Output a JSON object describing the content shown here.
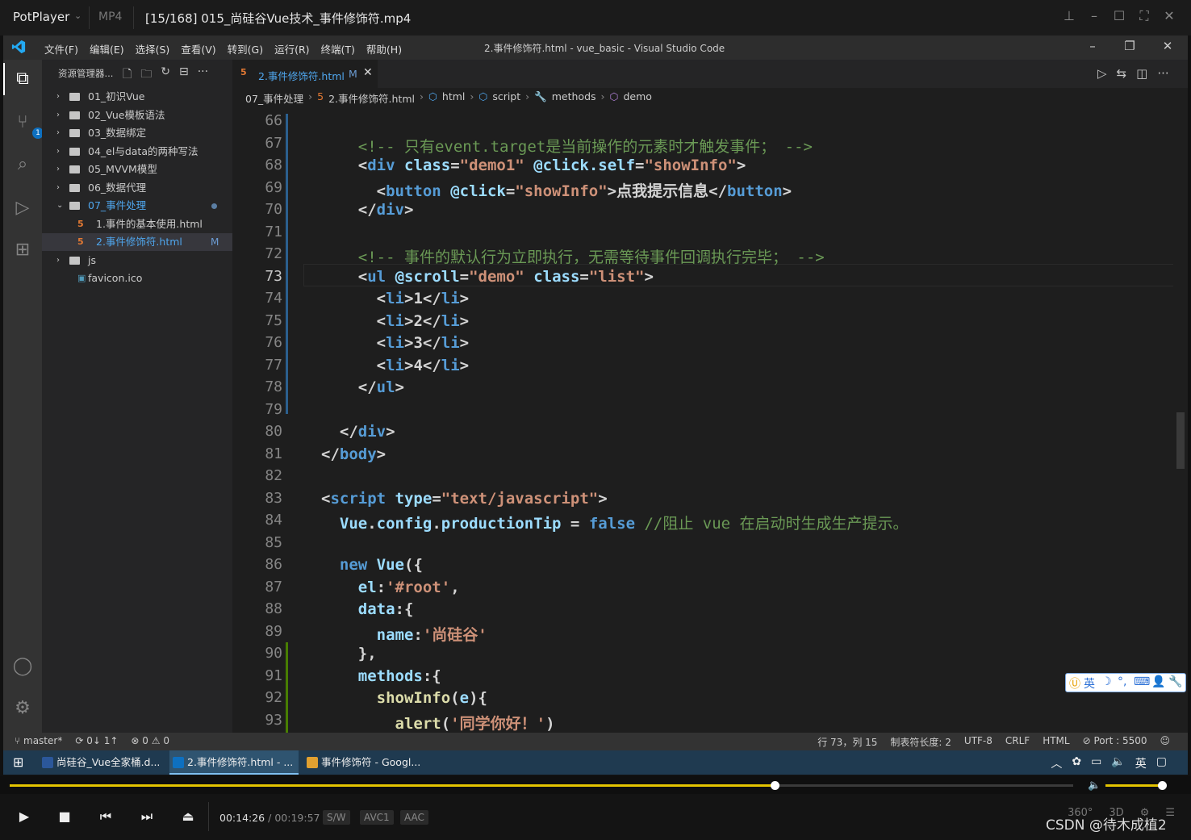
{
  "player": {
    "app_name": "PotPlayer",
    "format": "MP4",
    "file_title": "[15/168] 015_尚硅谷Vue技术_事件修饰符.mp4",
    "current_time": "00:14:26",
    "separator": "/",
    "total_time": "00:19:57",
    "chips": [
      "S/W",
      "AVC1",
      "AAC"
    ],
    "progress_fraction": 0.72,
    "volume_fraction": 0.9,
    "right_icons": [
      "360°",
      "3D"
    ],
    "watermark": "CSDN @待木成植2"
  },
  "vscode": {
    "window_title": "2.事件修饰符.html - vue_basic - Visual Studio Code",
    "menu": [
      "文件(F)",
      "编辑(E)",
      "选择(S)",
      "查看(V)",
      "转到(G)",
      "运行(R)",
      "终端(T)",
      "帮助(H)"
    ],
    "explorer_title": "资源管理器...",
    "tree": [
      {
        "label": "01_初识Vue",
        "type": "folder"
      },
      {
        "label": "02_Vue模板语法",
        "type": "folder"
      },
      {
        "label": "03_数据绑定",
        "type": "folder"
      },
      {
        "label": "04_el与data的两种写法",
        "type": "folder"
      },
      {
        "label": "05_MVVM模型",
        "type": "folder"
      },
      {
        "label": "06_数据代理",
        "type": "folder"
      },
      {
        "label": "07_事件处理",
        "type": "folder-open"
      },
      {
        "label": "1.事件的基本使用.html",
        "type": "html"
      },
      {
        "label": "2.事件修饰符.html",
        "type": "html",
        "badge": "M"
      },
      {
        "label": "js",
        "type": "folder"
      },
      {
        "label": "favicon.ico",
        "type": "ico"
      }
    ],
    "tab": {
      "label": "2.事件修饰符.html",
      "badge": "M"
    },
    "breadcrumb": [
      "07_事件处理",
      "2.事件修饰符.html",
      "html",
      "script",
      "methods",
      "demo"
    ],
    "code_lines": [
      {
        "n": "66",
        "html": ""
      },
      {
        "n": "67",
        "html": "    <span class='t-com'>&lt;!-- 只有event.target是当前操作的元素时才触发事件； --&gt;</span>"
      },
      {
        "n": "68",
        "html": "    <span class='t-tag'>&lt;</span><span class='t-kw'>div</span> <span class='t-attr'>class</span>=<span class='t-str'>\"demo1\"</span> <span class='t-attr'>@click.self</span>=<span class='t-str'>\"showInfo\"</span><span class='t-tag'>&gt;</span>"
      },
      {
        "n": "69",
        "html": "      <span class='t-tag'>&lt;</span><span class='t-kw'>button</span> <span class='t-attr'>@click</span>=<span class='t-str'>\"showInfo\"</span><span class='t-tag'>&gt;</span>点我提示信息<span class='t-tag'>&lt;/</span><span class='t-kw'>button</span><span class='t-tag'>&gt;</span>"
      },
      {
        "n": "70",
        "html": "    <span class='t-tag'>&lt;/</span><span class='t-kw'>div</span><span class='t-tag'>&gt;</span>"
      },
      {
        "n": "71",
        "html": ""
      },
      {
        "n": "72",
        "html": "    <span class='t-com'>&lt;!-- 事件的默认行为立即执行，无需等待事件回调执行完毕； --&gt;</span>"
      },
      {
        "n": "73",
        "html": "    <span class='t-tag'>&lt;</span><span class='t-kw'>ul</span> <span class='t-attr'>@scroll</span>=<span class='t-str'>\"demo\"</span> <span class='t-attr'>class</span>=<span class='t-str'>\"list\"</span><span class='t-tag'>&gt;</span>",
        "current": true
      },
      {
        "n": "74",
        "html": "      <span class='t-tag'>&lt;</span><span class='t-kw'>li</span><span class='t-tag'>&gt;</span>1<span class='t-tag'>&lt;/</span><span class='t-kw'>li</span><span class='t-tag'>&gt;</span>"
      },
      {
        "n": "75",
        "html": "      <span class='t-tag'>&lt;</span><span class='t-kw'>li</span><span class='t-tag'>&gt;</span>2<span class='t-tag'>&lt;/</span><span class='t-kw'>li</span><span class='t-tag'>&gt;</span>"
      },
      {
        "n": "76",
        "html": "      <span class='t-tag'>&lt;</span><span class='t-kw'>li</span><span class='t-tag'>&gt;</span>3<span class='t-tag'>&lt;/</span><span class='t-kw'>li</span><span class='t-tag'>&gt;</span>"
      },
      {
        "n": "77",
        "html": "      <span class='t-tag'>&lt;</span><span class='t-kw'>li</span><span class='t-tag'>&gt;</span>4<span class='t-tag'>&lt;/</span><span class='t-kw'>li</span><span class='t-tag'>&gt;</span>"
      },
      {
        "n": "78",
        "html": "    <span class='t-tag'>&lt;/</span><span class='t-kw'>ul</span><span class='t-tag'>&gt;</span>"
      },
      {
        "n": "79",
        "html": ""
      },
      {
        "n": "80",
        "html": "  <span class='t-tag'>&lt;/</span><span class='t-kw'>div</span><span class='t-tag'>&gt;</span>"
      },
      {
        "n": "81",
        "html": "<span class='t-tag'>&lt;/</span><span class='t-kw'>body</span><span class='t-tag'>&gt;</span>"
      },
      {
        "n": "82",
        "html": ""
      },
      {
        "n": "83",
        "html": "<span class='t-tag'>&lt;</span><span class='t-kw'>script</span> <span class='t-attr'>type</span>=<span class='t-str'>\"text/javascript\"</span><span class='t-tag'>&gt;</span>"
      },
      {
        "n": "84",
        "html": "  <span class='t-var'>Vue</span>.<span class='t-var'>config</span>.<span class='t-var'>productionTip</span> = <span class='t-kw'>false</span> <span class='t-com'>//阻止 vue 在启动时生成生产提示。</span>"
      },
      {
        "n": "85",
        "html": ""
      },
      {
        "n": "86",
        "html": "  <span class='t-kw'>new</span> <span class='t-var'>Vue</span>({"
      },
      {
        "n": "87",
        "html": "    <span class='t-var'>el</span>:<span class='t-str'>'#root'</span>,"
      },
      {
        "n": "88",
        "html": "    <span class='t-var'>data</span>:{"
      },
      {
        "n": "89",
        "html": "      <span class='t-var'>name</span>:<span class='t-str'>'尚硅谷'</span>"
      },
      {
        "n": "90",
        "html": "    },"
      },
      {
        "n": "91",
        "html": "    <span class='t-var'>methods</span>:{"
      },
      {
        "n": "92",
        "html": "      <span class='t-fn'>showInfo</span>(<span class='t-var'>e</span>){"
      },
      {
        "n": "93",
        "html": "        <span class='t-fn'>alert</span>(<span class='t-str'>'同学你好！'</span>)"
      }
    ],
    "status_left": [
      "master*",
      "0↓ 1↑",
      "⊗ 0 ⚠ 0"
    ],
    "status_right": [
      "行 73，列 15",
      "制表符长度: 2",
      "UTF-8",
      "CRLF",
      "HTML",
      "⊘ Port : 5500"
    ],
    "ime": [
      "英",
      "☽",
      "°,",
      "⌨",
      "👤",
      "🔧"
    ]
  },
  "taskbar": {
    "items": [
      {
        "label": "尚硅谷_Vue全家桶.d...",
        "color": "#2b579a"
      },
      {
        "label": "2.事件修饰符.html - ...",
        "color": "#0e70c0",
        "active": true
      },
      {
        "label": "事件修饰符 - Googl...",
        "color": "#e0a030"
      }
    ],
    "tray_lang": "英"
  }
}
